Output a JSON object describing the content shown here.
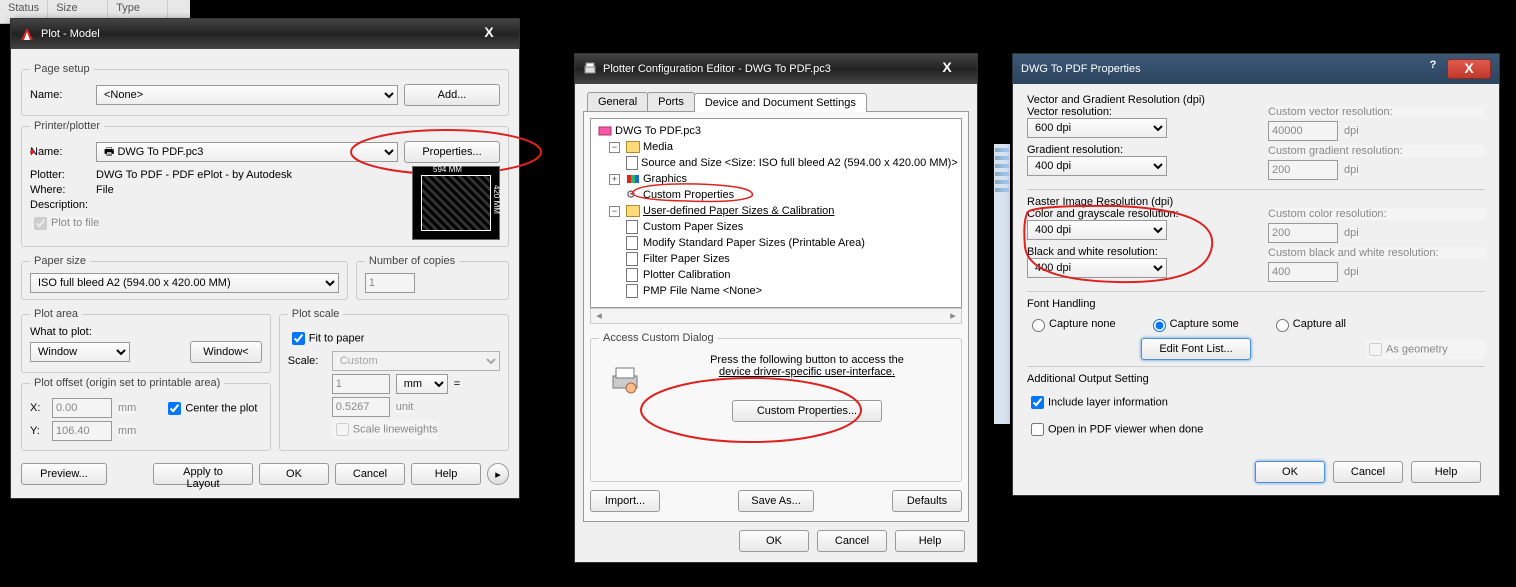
{
  "bgStrip": {
    "status": "Status",
    "size": "Size",
    "type": "Type"
  },
  "plot": {
    "title": "Plot - Model",
    "pageSetup": {
      "legend": "Page setup",
      "nameLabel": "Name:",
      "nameValue": "<None>",
      "addBtn": "Add..."
    },
    "printer": {
      "legend": "Printer/plotter",
      "nameLabel": "Name:",
      "nameValue": "DWG To PDF.pc3",
      "propsBtn": "Properties...",
      "plotterLabel": "Plotter:",
      "plotterVal": "DWG To PDF - PDF ePlot - by Autodesk",
      "whereLabel": "Where:",
      "whereVal": "File",
      "descLabel": "Description:",
      "plotToFile": "Plot to file",
      "previewTop": "594 MM",
      "previewRight": "420 MM"
    },
    "paper": {
      "legend": "Paper size",
      "value": "ISO full bleed A2 (594.00 x 420.00 MM)",
      "copiesLabel": "Number of copies",
      "copiesVal": "1"
    },
    "area": {
      "legend": "Plot area",
      "whatLabel": "What to plot:",
      "whatVal": "Window",
      "windowBtn": "Window<"
    },
    "scale": {
      "legend": "Plot scale",
      "fit": "Fit to paper",
      "scaleLabel": "Scale:",
      "scaleVal": "Custom",
      "unitsVal": "1",
      "unitsSel": "mm",
      "unit2": "0.5267",
      "unit2txt": "unit",
      "scaleLW": "Scale lineweights"
    },
    "offset": {
      "legend": "Plot offset (origin set to printable area)",
      "xLabel": "X:",
      "xVal": "0.00",
      "yLabel": "Y:",
      "yVal": "106.40",
      "mm": "mm",
      "center": "Center the plot"
    },
    "buttons": {
      "preview": "Preview...",
      "apply": "Apply to Layout",
      "ok": "OK",
      "cancel": "Cancel",
      "help": "Help"
    },
    "eq": "="
  },
  "pce": {
    "title": "Plotter Configuration Editor - DWG To PDF.pc3",
    "tabs": {
      "general": "General",
      "ports": "Ports",
      "dds": "Device and Document Settings"
    },
    "tree": {
      "root": "DWG To PDF.pc3",
      "media": "Media",
      "source": "Source and Size <Size: ISO full bleed A2 (594.00 x 420.00 MM)>",
      "graphics": "Graphics",
      "custom": "Custom Properties",
      "udps": "User-defined Paper Sizes & Calibration",
      "cps": "Custom Paper Sizes",
      "msps": "Modify Standard Paper Sizes (Printable Area)",
      "fps": "Filter Paper Sizes",
      "pcal": "Plotter Calibration",
      "pmp": "PMP File Name <None>"
    },
    "access": {
      "legend": "Access Custom Dialog",
      "text1": "Press the following button to access the",
      "text2": "device driver-specific user-interface.",
      "btn": "Custom Properties..."
    },
    "buttons": {
      "import": "Import...",
      "saveas": "Save As...",
      "defaults": "Defaults",
      "ok": "OK",
      "cancel": "Cancel",
      "help": "Help"
    }
  },
  "dwg": {
    "title": "DWG To PDF Properties",
    "vg": {
      "legend": "Vector and Gradient Resolution (dpi)",
      "vrLabel": "Vector resolution:",
      "vrVal": "600 dpi",
      "cvrLabel": "Custom vector resolution:",
      "cvrVal": "40000",
      "dpi": "dpi",
      "grLabel": "Gradient resolution:",
      "grVal": "400 dpi",
      "cgrLabel": "Custom gradient resolution:",
      "cgrVal": "200"
    },
    "ri": {
      "legend": "Raster Image Resolution (dpi)",
      "cgLabel": "Color and grayscale resolution:",
      "cgVal": "400 dpi",
      "ccrLabel": "Custom color resolution:",
      "ccrVal": "200",
      "bwLabel": "Black and white resolution:",
      "bwVal": "400 dpi",
      "cbwLabel": "Custom black and white resolution:",
      "cbwVal": "400"
    },
    "fh": {
      "legend": "Font Handling",
      "none": "Capture none",
      "some": "Capture some",
      "all": "Capture all",
      "edit": "Edit Font List...",
      "geom": "As geometry"
    },
    "ao": {
      "legend": "Additional Output Setting",
      "include": "Include layer information",
      "open": "Open in PDF viewer when done"
    },
    "buttons": {
      "ok": "OK",
      "cancel": "Cancel",
      "help": "Help"
    }
  }
}
